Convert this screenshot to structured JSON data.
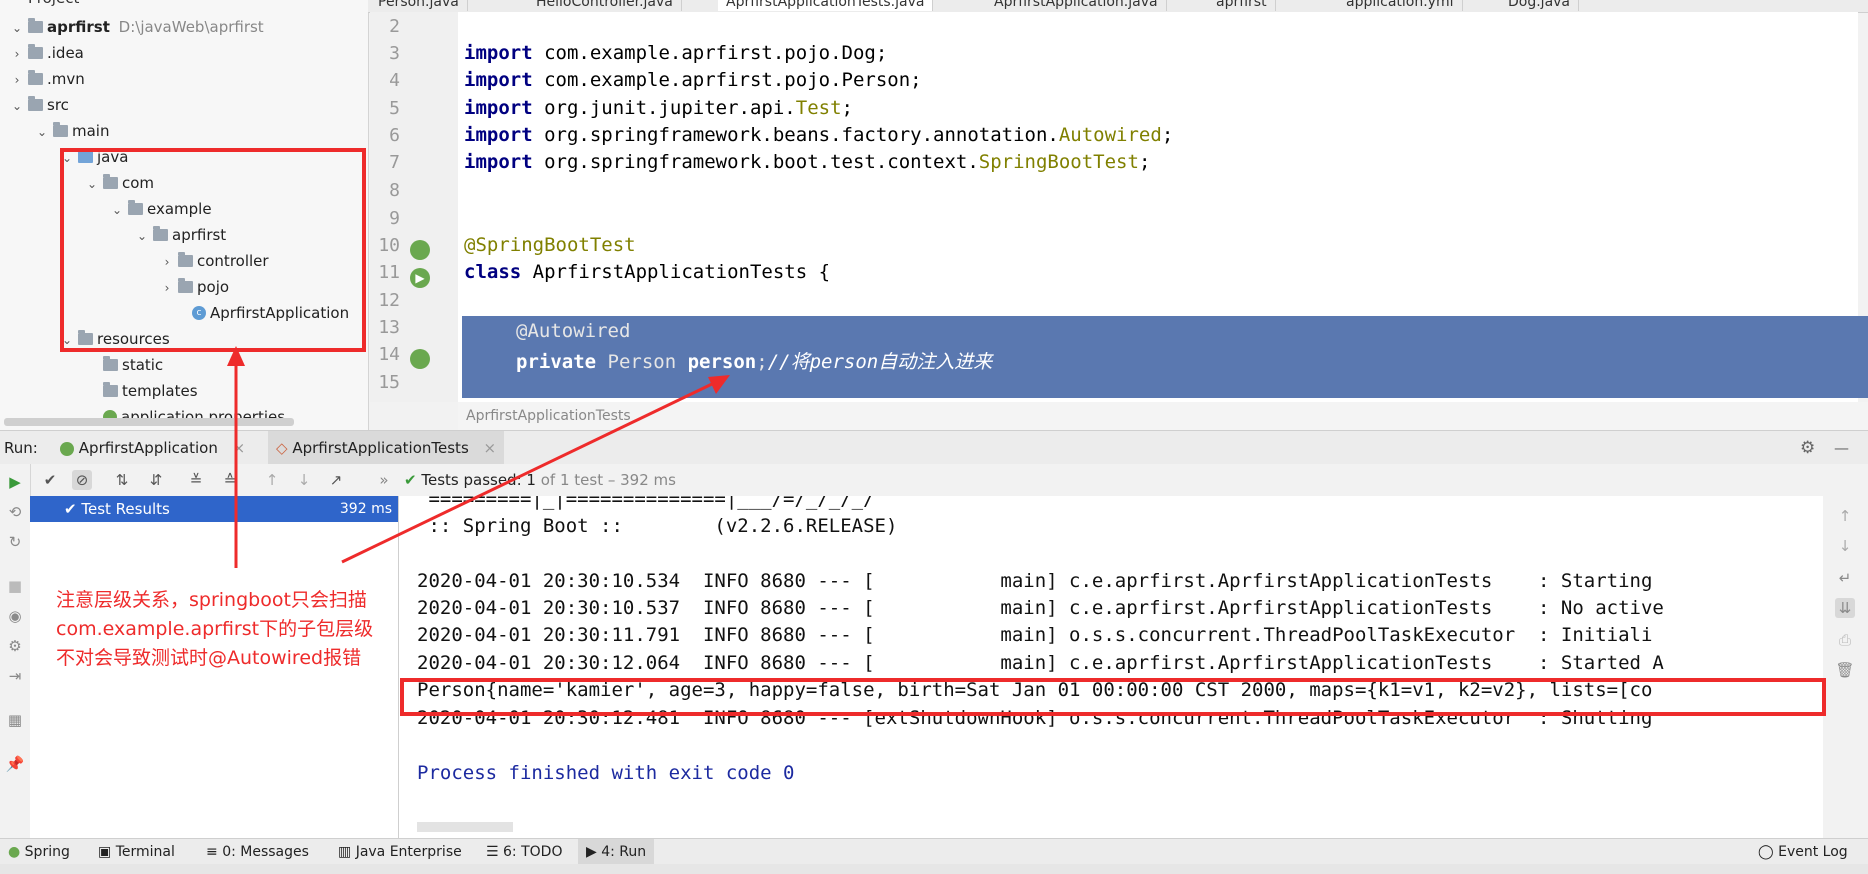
{
  "project": {
    "header": "Project",
    "root_name": "aprfirst",
    "root_path": "D:\\javaWeb\\aprfirst",
    "items": [
      {
        "label": ".idea"
      },
      {
        "label": ".mvn"
      },
      {
        "label": "src"
      },
      {
        "label": "main"
      },
      {
        "label": "java"
      },
      {
        "label": "com"
      },
      {
        "label": "example"
      },
      {
        "label": "aprfirst"
      },
      {
        "label": "controller"
      },
      {
        "label": "pojo"
      },
      {
        "label": "AprfirstApplication"
      },
      {
        "label": "resources"
      },
      {
        "label": "static"
      },
      {
        "label": "templates"
      },
      {
        "label": "application.properties"
      }
    ]
  },
  "tabs": [
    {
      "label": "Person.java"
    },
    {
      "label": "HelloController.java"
    },
    {
      "label": "AprfirstApplicationTests.java"
    },
    {
      "label": "AprfirstApplication.java"
    },
    {
      "label": "aprfirst"
    },
    {
      "label": "application.yml"
    },
    {
      "label": "Dog.java"
    }
  ],
  "editor": {
    "line_numbers": [
      "2",
      "3",
      "4",
      "5",
      "6",
      "7",
      "8",
      "9",
      "10",
      "11",
      "12",
      "13",
      "14",
      "15"
    ],
    "imp": "import",
    "l3_pkg": "com.example.aprfirst.pojo.Dog;",
    "l4_pkg": "com.example.aprfirst.pojo.Person;",
    "l5_pkg": "org.junit.jupiter.api.",
    "l5_cls": "Test",
    "l6_pkg": "org.springframework.beans.factory.annotation.",
    "l6_cls": "Autowired",
    "l7_pkg": "org.springframework.boot.test.context.",
    "l7_cls": "SpringBootTest",
    "semi": ";",
    "l10": "@SpringBootTest",
    "l11_kw": "class",
    "l11_rest": " AprfirstApplicationTests {",
    "l13": "@Autowired",
    "l14_kw": "private",
    "l14_type": " Person ",
    "l14_var": "person",
    "l14_semi": ";",
    "l14_comment": "//将person自动注入进来",
    "breadcrumb": "AprfirstApplicationTests"
  },
  "run": {
    "label": "Run:",
    "tab1": "AprfirstApplication",
    "tab2": "AprfirstApplicationTests",
    "tests_passed": "Tests passed:",
    "tests_count": "1",
    "tests_detail": " of 1 test – 392 ms",
    "result_label": "Test Results",
    "result_time": "392 ms"
  },
  "console": {
    "lines": [
      " =========|_|==============|___/=/_/_/_/",
      " :: Spring Boot ::        (v2.2.6.RELEASE)",
      "",
      "2020-04-01 20:30:10.534  INFO 8680 --- [           main] c.e.aprfirst.AprfirstApplicationTests    : Starting",
      "2020-04-01 20:30:10.537  INFO 8680 --- [           main] c.e.aprfirst.AprfirstApplicationTests    : No active",
      "2020-04-01 20:30:11.791  INFO 8680 --- [           main] o.s.s.concurrent.ThreadPoolTaskExecutor  : Initiali",
      "2020-04-01 20:30:12.064  INFO 8680 --- [           main] c.e.aprfirst.AprfirstApplicationTests    : Started A",
      "Person{name='kamier', age=3, happy=false, birth=Sat Jan 01 00:00:00 CST 2000, maps={k1=v1, k2=v2}, lists=[co",
      "2020-04-01 20:30:12.481  INFO 8680 --- [extShutdownHook] o.s.s.concurrent.ThreadPoolTaskExecutor  : Shutting",
      "",
      "Process finished with exit code 0"
    ]
  },
  "annotation": {
    "text": "注意层级关系，springboot只会扫描com.example.aprfirst下的子包层级不对会导致测试时@Autowired报错",
    "color": "#ee2b2b"
  },
  "bottom": {
    "spring": "Spring",
    "terminal": "Terminal",
    "messages": "0: Messages",
    "java_enterprise": "Java Enterprise",
    "todo": "6: TODO",
    "run": "4: Run",
    "event_log": "Event Log"
  },
  "colors": {
    "selection": "#5a78b0",
    "keyword": "#000080",
    "annotation": "#808000",
    "accent": "#2f65ca"
  }
}
